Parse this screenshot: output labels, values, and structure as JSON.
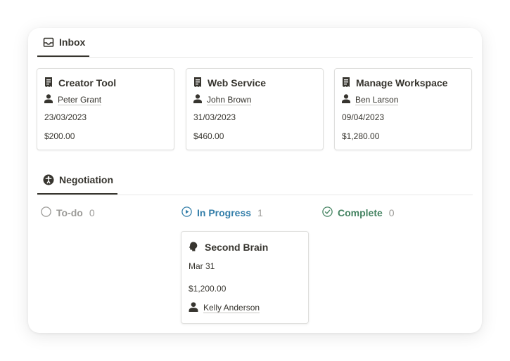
{
  "inbox": {
    "tab_label": "Inbox",
    "cards": [
      {
        "title": "Creator Tool",
        "person": "Peter Grant",
        "date": "23/03/2023",
        "amount": "$200.00"
      },
      {
        "title": "Web Service",
        "person": "John Brown",
        "date": "31/03/2023",
        "amount": "$460.00"
      },
      {
        "title": "Manage Workspace",
        "person": "Ben Larson",
        "date": "09/04/2023",
        "amount": "$1,280.00"
      }
    ]
  },
  "negotiation": {
    "tab_label": "Negotiation",
    "columns": [
      {
        "label": "To-do",
        "count": "0",
        "color": "#9b9a97"
      },
      {
        "label": "In Progress",
        "count": "1",
        "color": "#337ea9"
      },
      {
        "label": "Complete",
        "count": "0",
        "color": "#448361"
      }
    ],
    "card": {
      "title": "Second Brain",
      "date": "Mar 31",
      "amount": "$1,200.00",
      "person": "Kelly Anderson"
    }
  }
}
